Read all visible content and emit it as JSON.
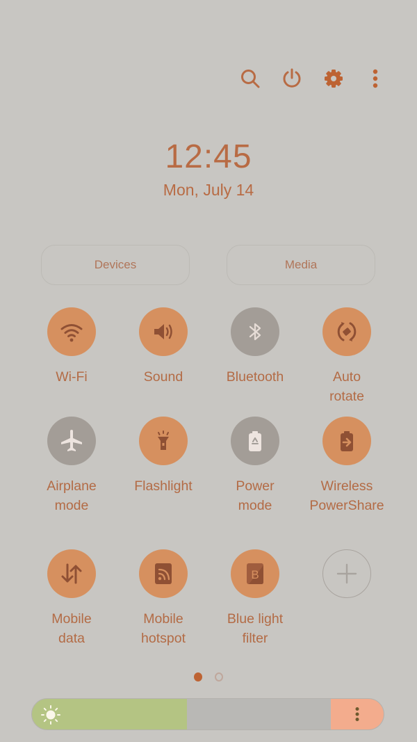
{
  "topbar": {
    "icons": [
      "search-icon",
      "power-icon",
      "settings-icon",
      "more-options-icon"
    ]
  },
  "clock": {
    "time": "12:45",
    "date": "Mon, July 14"
  },
  "buttons": {
    "devices": "Devices",
    "media": "Media"
  },
  "tiles": [
    {
      "label": "Wi-Fi",
      "icon": "wifi-icon",
      "state": "on"
    },
    {
      "label": "Sound",
      "icon": "sound-icon",
      "state": "on"
    },
    {
      "label": "Bluetooth",
      "icon": "bluetooth-icon",
      "state": "off"
    },
    {
      "label": "Auto\nrotate",
      "icon": "auto-rotate-icon",
      "state": "on"
    },
    {
      "label": "Airplane\nmode",
      "icon": "airplane-icon",
      "state": "off"
    },
    {
      "label": "Flashlight",
      "icon": "flashlight-icon",
      "state": "on"
    },
    {
      "label": "Power\nmode",
      "icon": "power-mode-icon",
      "state": "off"
    },
    {
      "label": "Wireless\nPowerShare",
      "icon": "wireless-powershare-icon",
      "state": "on"
    },
    {
      "label": "Mobile\ndata",
      "icon": "mobile-data-icon",
      "state": "on"
    },
    {
      "label": "Mobile\nhotspot",
      "icon": "mobile-hotspot-icon",
      "state": "on"
    },
    {
      "label": "Blue light\nfilter",
      "icon": "blue-light-filter-icon",
      "state": "on"
    },
    {
      "label": "",
      "icon": "add-icon",
      "state": "add"
    }
  ],
  "pager": {
    "pages": 2,
    "current": 1
  },
  "brightness": {
    "level_fraction": 0.44,
    "icon": "sun-icon",
    "menu_icon": "more-options-icon"
  },
  "colors": {
    "background": "#c8c6c2",
    "accent": "#b86b44",
    "tile_on": "#d6905f",
    "tile_off": "#a39d97",
    "brightness_fill": "#b4c483",
    "brightness_end": "#f3ac8d"
  }
}
